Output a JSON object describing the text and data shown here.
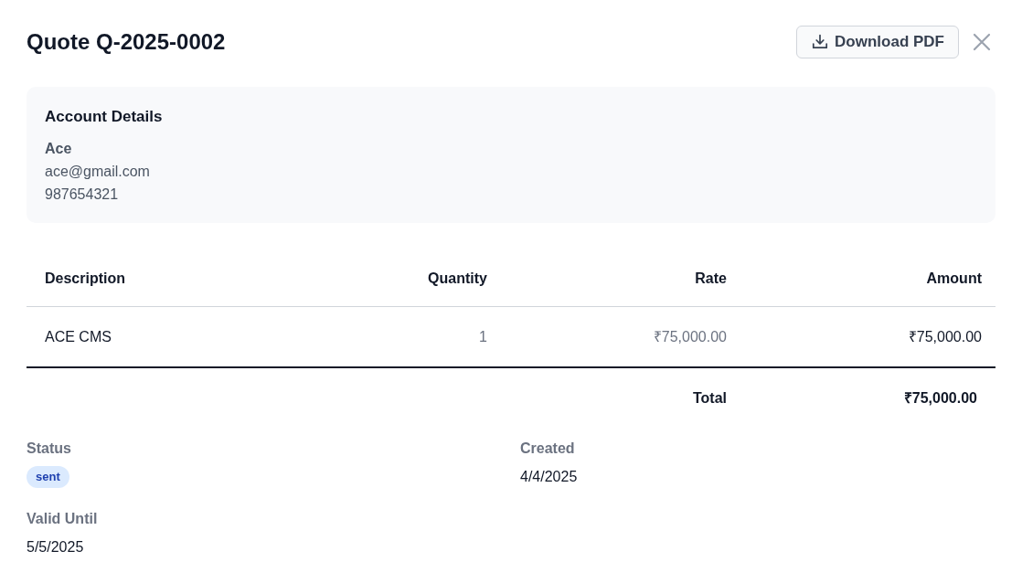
{
  "dialog": {
    "title": "Quote Q-2025-0002",
    "download_button": {
      "label": "Download PDF"
    }
  },
  "account": {
    "heading": "Account Details",
    "name": "Ace",
    "email": "ace@gmail.com",
    "phone": "987654321"
  },
  "table": {
    "columns": [
      "Description",
      "Quantity",
      "Rate",
      "Amount"
    ],
    "rows": [
      {
        "cells": [
          "ACE CMS",
          "1",
          "₹75,000.00",
          "₹75,000.00"
        ]
      }
    ],
    "total": {
      "label": "Total",
      "value": "₹75,000.00"
    }
  },
  "details": [
    {
      "kind": "badge",
      "label": "Status",
      "value": "sent"
    },
    {
      "kind": "text",
      "label": "Created",
      "value": "4/4/2025"
    },
    {
      "kind": "text",
      "label": "Valid Until",
      "value": "5/5/2025"
    }
  ]
}
